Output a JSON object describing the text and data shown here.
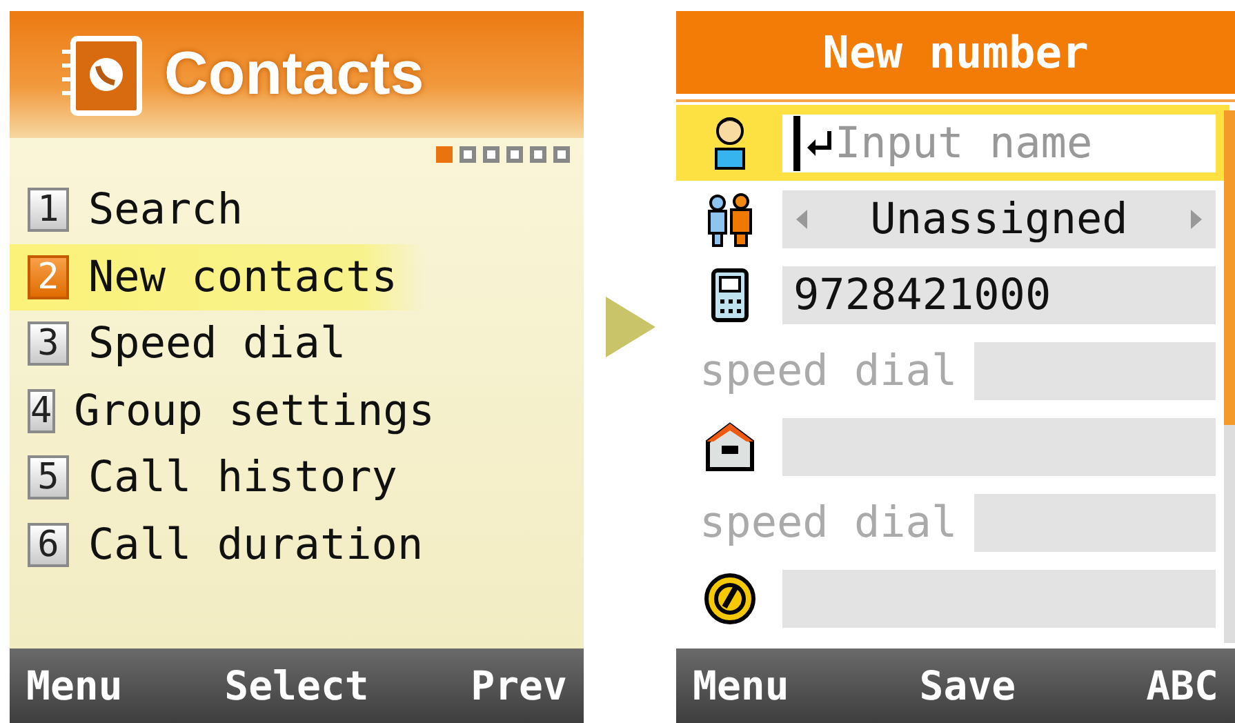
{
  "contacts_screen": {
    "title": "Contacts",
    "page_indicator": [
      {
        "selected": true
      },
      {
        "selected": false
      },
      {
        "selected": false
      },
      {
        "selected": false
      },
      {
        "selected": false
      },
      {
        "selected": false
      }
    ],
    "menu": [
      {
        "number": "1",
        "label": "Search",
        "selected": false
      },
      {
        "number": "2",
        "label": "New contacts",
        "selected": true
      },
      {
        "number": "3",
        "label": "Speed dial",
        "selected": false
      },
      {
        "number": "4",
        "label": "Group settings",
        "selected": false
      },
      {
        "number": "5",
        "label": "Call history",
        "selected": false
      },
      {
        "number": "6",
        "label": "Call duration",
        "selected": false
      }
    ],
    "softkeys": [
      "Menu",
      "Select",
      "Prev"
    ]
  },
  "new_number_screen": {
    "title": "New number",
    "fields": [
      {
        "kind": "name",
        "placeholder": "Input name",
        "selected": true
      },
      {
        "kind": "group",
        "value": "Unassigned",
        "selected": false
      },
      {
        "kind": "mobile",
        "value": "9728421000",
        "selected": false
      },
      {
        "kind": "speed_dial",
        "label": "speed dial",
        "selected": false
      },
      {
        "kind": "home",
        "selected": false
      },
      {
        "kind": "speed_dial",
        "label": "speed dial",
        "selected": false
      },
      {
        "kind": "email",
        "selected": false
      }
    ],
    "softkeys": [
      "Menu",
      "Save",
      "ABC"
    ]
  }
}
